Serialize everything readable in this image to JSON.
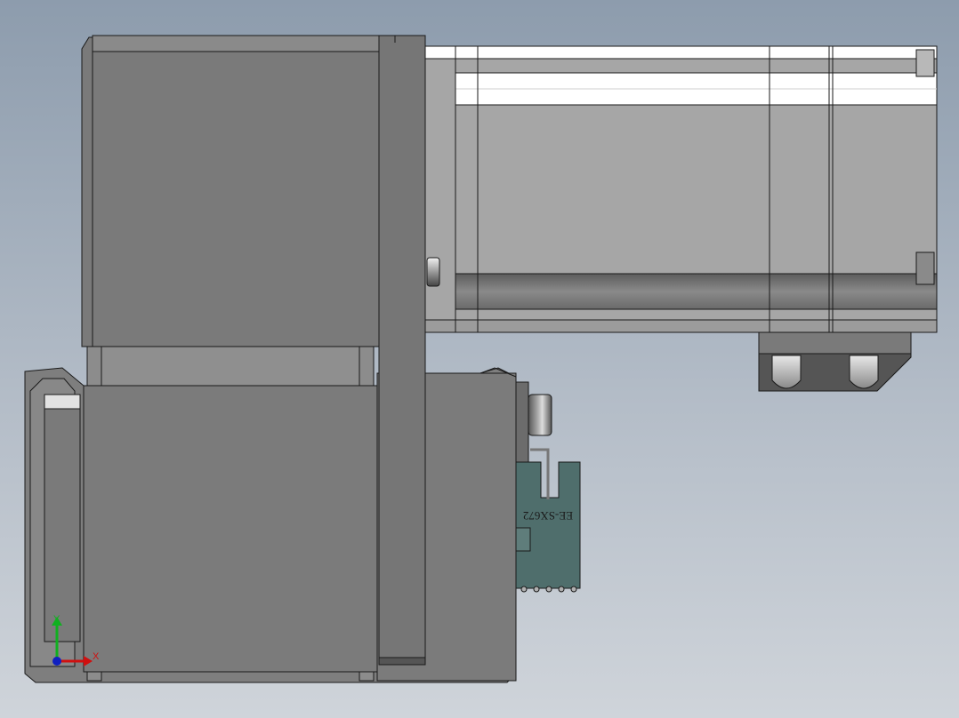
{
  "viewport": {
    "background_top": "#8d9cad",
    "background_bottom": "#cfd4da"
  },
  "parts": {
    "sensor_label": "EE-SX672"
  },
  "triad": {
    "x_label": "X",
    "y_label": "Y",
    "x_color": "#d01010",
    "y_color": "#10b020",
    "origin_color": "#1020c0"
  },
  "colors": {
    "housing_dark": "#7a7a7a",
    "housing_mid": "#888888",
    "motor_body": "#a6a6a6",
    "motor_highlight": "#ffffff",
    "sensor_teal": "#4f6e6c",
    "outline": "#1a1a1a"
  }
}
